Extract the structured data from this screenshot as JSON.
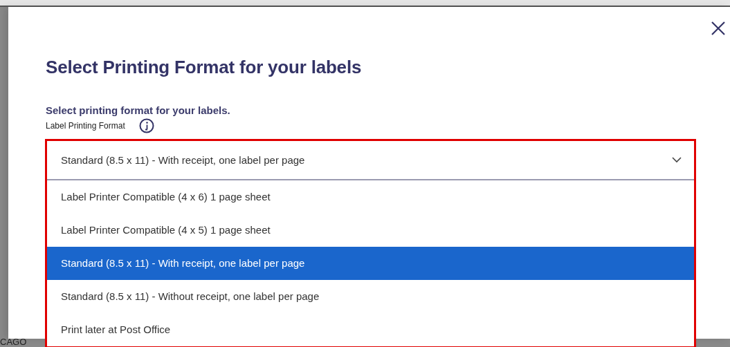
{
  "dialog": {
    "title": "Select Printing Format for your labels",
    "subtitle": "Select printing format for your labels.",
    "field": {
      "label": "Label Printing Format",
      "value": "Standard (8.5 x 11) - With receipt, one label per page",
      "expanded": true,
      "options": [
        {
          "label": "Label Printer Compatible (4 x 6) 1 page sheet",
          "selected": false
        },
        {
          "label": "Label Printer Compatible (4 x 5) 1 page sheet",
          "selected": false
        },
        {
          "label": "Standard (8.5 x 11) - With receipt, one label per page",
          "selected": true
        },
        {
          "label": "Standard (8.5 x 11) - Without receipt, one label per page",
          "selected": false
        },
        {
          "label": "Print later at Post Office",
          "selected": false
        }
      ]
    }
  },
  "background": {
    "text": "CAGO"
  }
}
